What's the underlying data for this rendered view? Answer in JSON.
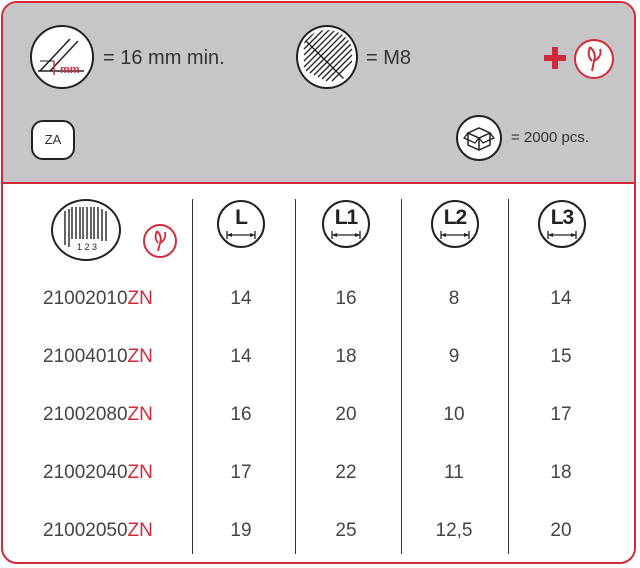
{
  "header": {
    "depth_text": "= 16 mm min.",
    "depth_icon_unit": "mm",
    "thread_text": "= M8",
    "finish_code": "ZA",
    "pack_text": "= 2000 pcs.",
    "accent_color": "#d22a3b"
  },
  "table": {
    "barcode_digits": "1 2 3",
    "columns": [
      "L",
      "L1",
      "L2",
      "L3"
    ],
    "rows": [
      {
        "code": "21002010",
        "suffix": "ZN",
        "L": "14",
        "L1": "16",
        "L2": "8",
        "L3": "14"
      },
      {
        "code": "21004010",
        "suffix": "ZN",
        "L": "14",
        "L1": "18",
        "L2": "9",
        "L3": "15"
      },
      {
        "code": "21002080",
        "suffix": "ZN",
        "L": "16",
        "L1": "20",
        "L2": "10",
        "L3": "17"
      },
      {
        "code": "21002040",
        "suffix": "ZN",
        "L": "17",
        "L1": "22",
        "L2": "11",
        "L3": "18"
      },
      {
        "code": "21002050",
        "suffix": "ZN",
        "L": "19",
        "L1": "25",
        "L2": "12,5",
        "L3": "20"
      }
    ]
  }
}
